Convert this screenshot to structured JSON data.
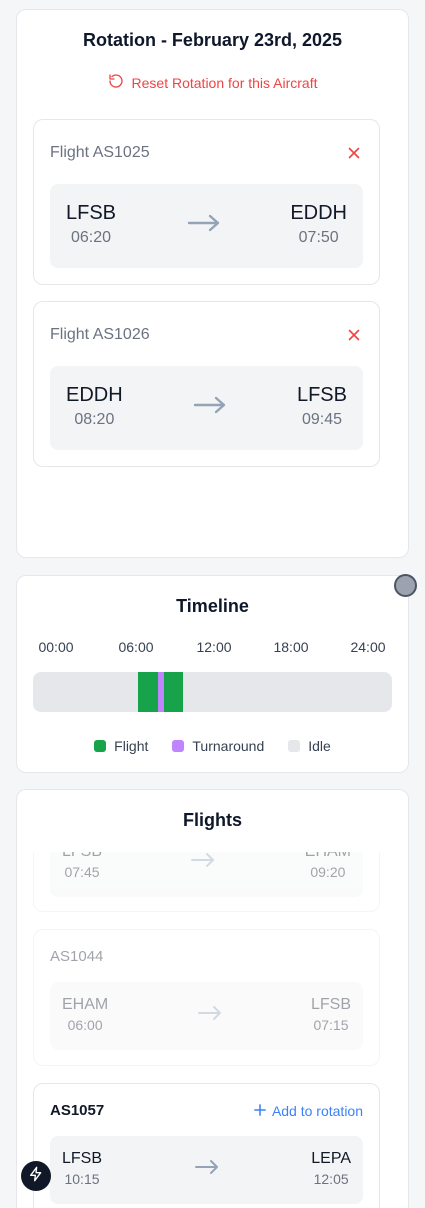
{
  "rotation": {
    "title": "Rotation - February 23rd, 2025",
    "reset_label": "Reset Rotation for this Aircraft",
    "flights": [
      {
        "label": "Flight AS1025",
        "from": "LFSB",
        "dep": "06:20",
        "to": "EDDH",
        "arr": "07:50"
      },
      {
        "label": "Flight AS1026",
        "from": "EDDH",
        "dep": "08:20",
        "to": "LFSB",
        "arr": "09:45"
      }
    ]
  },
  "timeline": {
    "title": "Timeline",
    "ticks": [
      "00:00",
      "06:00",
      "12:00",
      "18:00",
      "24:00"
    ],
    "segments": [
      {
        "kind": "flight",
        "start": 6.33,
        "end": 7.83
      },
      {
        "kind": "turnaround",
        "start": 7.83,
        "end": 8.33
      },
      {
        "kind": "flight",
        "start": 8.33,
        "end": 9.75
      }
    ],
    "legend": [
      {
        "label": "Flight",
        "color": "#16a34a"
      },
      {
        "label": "Turnaround",
        "color": "#c084fc"
      },
      {
        "label": "Idle",
        "color": "#e5e7eb"
      }
    ]
  },
  "flights_panel": {
    "title": "Flights",
    "add_label": "Add to rotation",
    "items": [
      {
        "number": "",
        "from": "LFSB",
        "dep": "07:45",
        "to": "EHAM",
        "arr": "09:20",
        "available": false
      },
      {
        "number": "AS1044",
        "from": "EHAM",
        "dep": "06:00",
        "to": "LFSB",
        "arr": "07:15",
        "available": false
      },
      {
        "number": "AS1057",
        "from": "LFSB",
        "dep": "10:15",
        "to": "LEPA",
        "arr": "12:05",
        "available": true
      }
    ]
  },
  "colors": {
    "flight": "#16a34a",
    "turnaround": "#c084fc",
    "idle": "#e5e7eb",
    "danger": "#ef4444",
    "accent": "#3b82f6"
  }
}
